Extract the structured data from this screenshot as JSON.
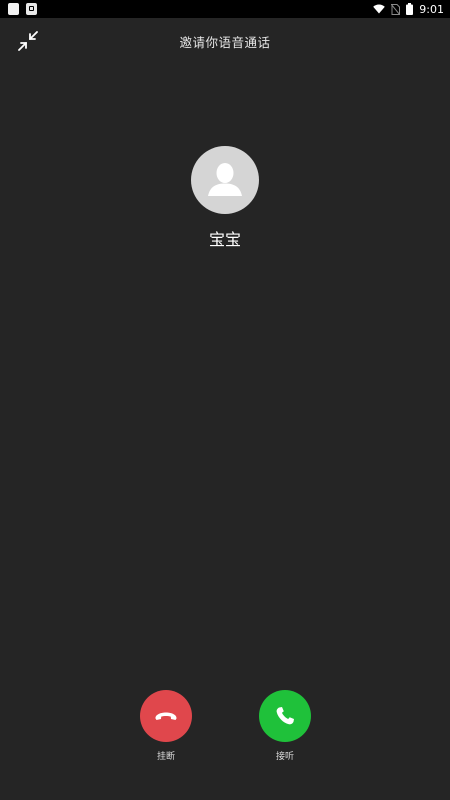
{
  "status_bar": {
    "time": "9:01",
    "icons": [
      "app-icon",
      "notification-icon",
      "wifi-icon",
      "no-sim-icon",
      "battery-icon"
    ]
  },
  "call": {
    "title": "邀请你语音通话",
    "caller_name": "宝宝",
    "avatar_icon": "person-icon",
    "minimize_icon": "minimize-icon"
  },
  "actions": {
    "hangup_label": "挂断",
    "answer_label": "接听",
    "hangup_color": "#e0474c",
    "answer_color": "#1fc13a"
  },
  "colors": {
    "background": "#252525",
    "status_bar": "#000000"
  }
}
